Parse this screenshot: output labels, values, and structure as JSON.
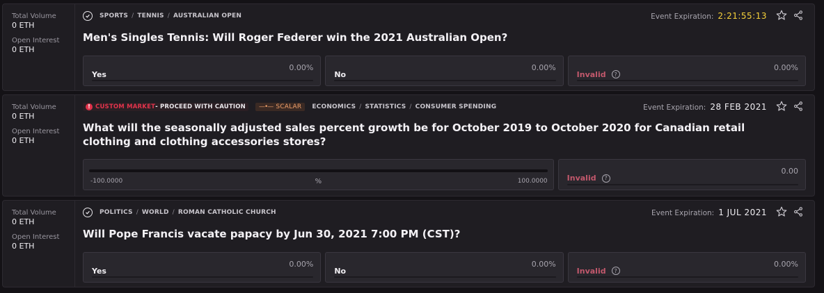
{
  "markets": [
    {
      "total_volume_label": "Total Volume",
      "total_volume": "0 ETH",
      "open_interest_label": "Open Interest",
      "open_interest": "0 ETH",
      "breadcrumb": [
        "SPORTS",
        "TENNIS",
        "AUSTRALIAN OPEN"
      ],
      "expiry_label": "Event Expiration:",
      "expiry_value": "2:21:55:13",
      "title": "Men's Singles Tennis: Will Roger Federer win the 2021 Australian Open?",
      "outcomes": [
        {
          "name": "Yes",
          "value": "0.00%"
        },
        {
          "name": "No",
          "value": "0.00%"
        },
        {
          "name": "Invalid",
          "value": "0.00%"
        }
      ]
    },
    {
      "total_volume_label": "Total Volume",
      "total_volume": "0 ETH",
      "open_interest_label": "Open Interest",
      "open_interest": "0 ETH",
      "warning_red": "CUSTOM MARKET",
      "warning_white": "- PROCEED WITH CAUTION",
      "scalar_label": "SCALAR",
      "breadcrumb": [
        "ECONOMICS",
        "STATISTICS",
        "CONSUMER SPENDING"
      ],
      "expiry_label": "Event Expiration:",
      "expiry_value": "28 FEB 2021",
      "title": "What will the seasonally adjusted sales percent growth be for October 2019 to October 2020 for Canadian retail clothing and clothing accessories stores?",
      "scalar_min": "-100.0000",
      "scalar_max": "100.0000",
      "scalar_unit": "%",
      "invalid": {
        "name": "Invalid",
        "value": "0.00"
      }
    },
    {
      "total_volume_label": "Total Volume",
      "total_volume": "0 ETH",
      "open_interest_label": "Open Interest",
      "open_interest": "0 ETH",
      "breadcrumb": [
        "POLITICS",
        "WORLD",
        "ROMAN CATHOLIC CHURCH"
      ],
      "expiry_label": "Event Expiration:",
      "expiry_value": "1 JUL 2021",
      "title": "Will Pope Francis vacate papacy by Jun 30, 2021 7:00 PM (CST)?",
      "outcomes": [
        {
          "name": "Yes",
          "value": "0.00%"
        },
        {
          "name": "No",
          "value": "0.00%"
        },
        {
          "name": "Invalid",
          "value": "0.00%"
        }
      ]
    }
  ],
  "icons": {
    "verified": "shield-check-icon",
    "favorite": "star-icon",
    "share": "share-icon",
    "help": "question-circle-icon",
    "warning": "exclamation-circle-icon"
  },
  "colors": {
    "countdown": "#f7d23a",
    "invalid": "#c2586c",
    "warning": "#e0334b",
    "scalar": "#f0a06a"
  }
}
